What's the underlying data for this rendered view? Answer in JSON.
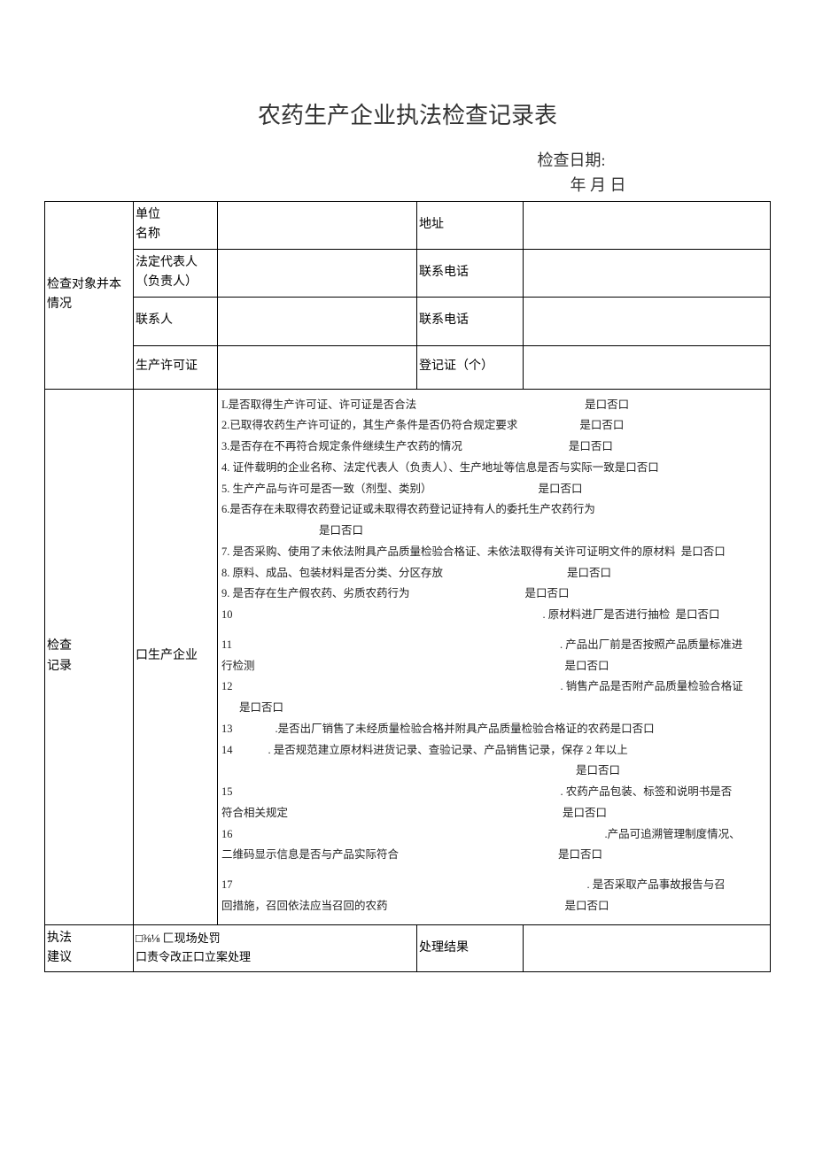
{
  "title": "农药生产企业执法检查记录表",
  "check_date_label": "检查日期:",
  "check_date_value": "年 月 日",
  "section_basic": "检查对象并本情况",
  "labels": {
    "unit_name": "单位\n名称",
    "address": "地址",
    "legal_rep": "法定代表人（负责人）",
    "phone1": "联系电话",
    "contact": "联系人",
    "phone2": "联系电话",
    "prod_license": "生产许可证",
    "reg_cert": "登记证（个）"
  },
  "section_check": "检查\n记录",
  "enterprise_type": "口生产企业",
  "yes_no": "是口否口",
  "yes_no_trail": "是口否口",
  "items": {
    "i1": "L是否取得生产许可证、许可证是否合法",
    "i2": "2.已取得农药生产许可证的，其生产条件是否仍符合规定要求",
    "i3": "3.是否存在不再符合规定条件继续生产农药的情况",
    "i4": "4. 证件载明的企业名称、法定代表人（负责人）、生产地址等信息是否与实际一致是口否口",
    "i5": "5. 生产产品与许可是否一致（剂型、类别）",
    "i6": "6.是否存在未取得农药登记证或未取得农药登记证持有人的委托生产农药行为",
    "i7": "7. 是否采购、使用了未依法附具产品质量检验合格证、未依法取得有关许可证明文件的原材料",
    "i7_tail": "是口否口",
    "i8": "8. 原料、成品、包装材料是否分类、分区存放",
    "i9": "9. 是否存在生产假农药、劣质农药行为",
    "i10_num": "10",
    "i10_text": ". 原材料进厂是否进行抽检",
    "i11_num": "11",
    "i11_text": ". 产品出厂前是否按照产品质量标准进",
    "i11_sub": "行检测",
    "i12_num": "12",
    "i12_text": ". 销售产品是否附产品质量检验合格证",
    "i13_num": "13",
    "i13_text": ".是否出厂销售了未经质量检验合格并附具产品质量检验合格证的农药是口否口",
    "i14_num": "14",
    "i14_text": ". 是否规范建立原材料进货记录、查验记录、产品销售记录，保存 2 年以上",
    "i15_num": "15",
    "i15_text": ". 农药产品包装、标签和说明书是否",
    "i15_sub": "符合相关规定",
    "i16_num": "16",
    "i16_text": ".产品可追溯管理制度情况、",
    "i16_sub": "二维码显示信息是否与产品实际符合",
    "i17_num": "17",
    "i17_text": ". 是否采取产品事故报告与召",
    "i17_sub": "回措施，召回依法应当召回的农药"
  },
  "section_advice": "执法\n建议",
  "advice_boxes": "□⅜⅛           匚现场处罚\n口责令改正口立案处理",
  "result_label": "处理结果"
}
